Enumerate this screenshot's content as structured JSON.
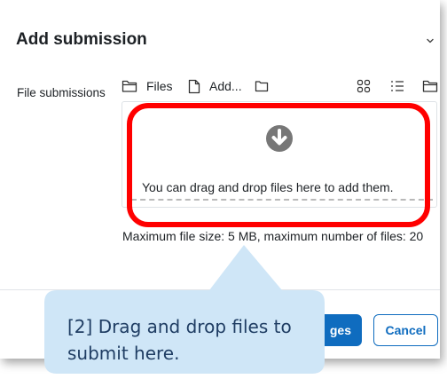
{
  "dialog": {
    "title": "Add submission",
    "field_label": "File submissions"
  },
  "filepicker": {
    "toolbar": {
      "files_label": "Files",
      "add_label": "Add..."
    },
    "dnd_text": "You can drag and drop files here to add them.",
    "max_info": "Maximum file size: 5 MB, maximum number of files: 20"
  },
  "footer": {
    "save_label": "ges",
    "cancel_label": "Cancel"
  },
  "callout": {
    "text": "[2] Drag and drop files to submit here.",
    "fill_color": "#cfe6f7",
    "text_color": "#1f3d63"
  },
  "highlight_color": "#ff0000"
}
